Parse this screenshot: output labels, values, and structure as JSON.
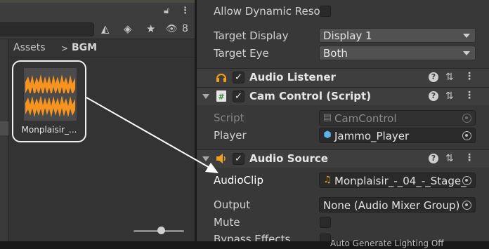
{
  "project": {
    "breadcrumb": {
      "root": "Assets",
      "separator": ">",
      "current": "BGM"
    },
    "hidden_count": "8",
    "asset": {
      "name": "Monplaisir_...",
      "icon": "audio-waveform-icon"
    },
    "icons": {
      "lock": "lock-icon",
      "more": "kebab-menu-icon",
      "filter_type": "shapes-icon",
      "filter_label": "tag-icon",
      "favorites": "star-icon",
      "visibility": "eye-slash-icon"
    }
  },
  "inspector": {
    "camera": {
      "allow_dynamic_resolution": {
        "label": "Allow Dynamic Reso",
        "checked": false
      },
      "target_display": {
        "label": "Target Display",
        "value": "Display 1"
      },
      "target_eye": {
        "label": "Target Eye",
        "value": "Both"
      }
    },
    "audio_listener": {
      "title": "Audio Listener",
      "enabled": true,
      "icon": "headphones-icon"
    },
    "cam_control": {
      "title": "Cam Control (Script)",
      "enabled": true,
      "icon": "csharp-script-icon",
      "script": {
        "label": "Script",
        "value": "CamControl"
      },
      "player": {
        "label": "Player",
        "value": "Jammo_Player"
      }
    },
    "audio_source": {
      "title": "Audio Source",
      "enabled": true,
      "icon": "speaker-icon",
      "audio_clip": {
        "label": "AudioClip",
        "value": "Monplaisir_-_04_-_Stage_"
      },
      "output": {
        "label": "Output",
        "value": "None (Audio Mixer Group)"
      },
      "mute": {
        "label": "Mute",
        "checked": false
      },
      "bypass_effects": {
        "label": "Bypass Effects",
        "checked": false
      }
    }
  },
  "status": {
    "text": "Auto Generate Lighting Off"
  },
  "colors": {
    "waveform": "#f7931e",
    "panel": "#383838",
    "project_panel": "#333333",
    "field": "#2a2a2a",
    "dropdown": "#515151",
    "arrow": "#ffffff"
  }
}
